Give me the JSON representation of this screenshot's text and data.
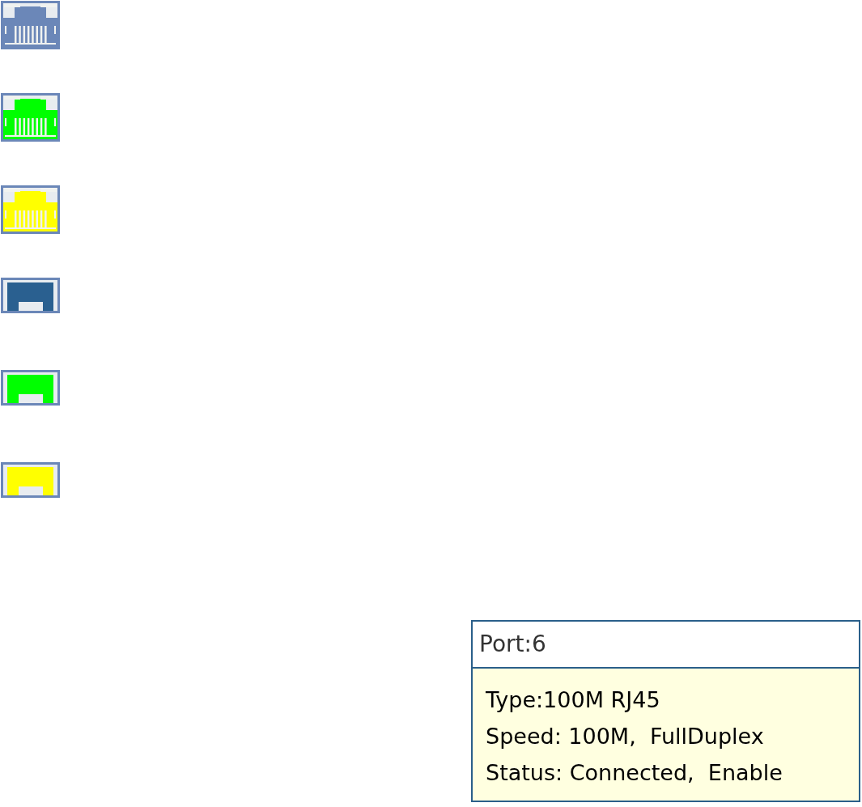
{
  "port_icons": [
    {
      "kind": "rj45",
      "color": "#6b87b8"
    },
    {
      "kind": "rj45",
      "color": "#00ff00"
    },
    {
      "kind": "rj45",
      "color": "#ffff00"
    },
    {
      "kind": "fiber",
      "color": "#2a6090"
    },
    {
      "kind": "fiber",
      "color": "#00ff00"
    },
    {
      "kind": "fiber",
      "color": "#ffff00"
    }
  ],
  "tooltip": {
    "title": "Port:6",
    "lines": [
      "Type:100M RJ45",
      "Speed: 100M,  FullDuplex",
      "Status: Connected,  Enable"
    ]
  }
}
